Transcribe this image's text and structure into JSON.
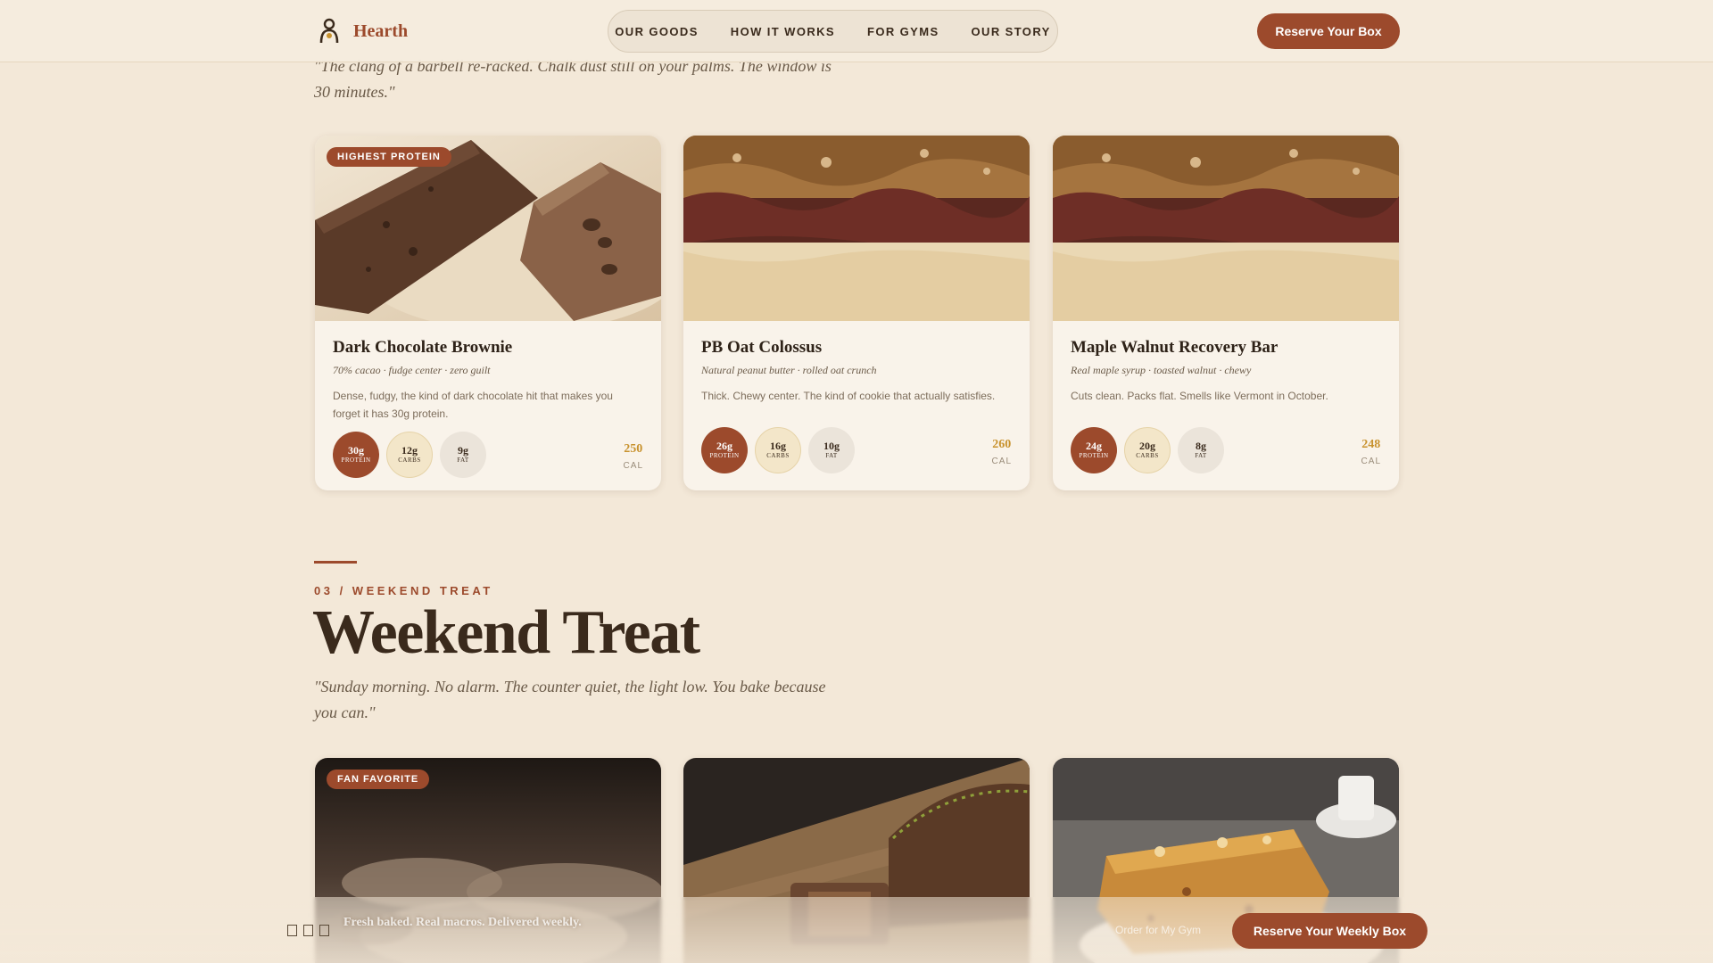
{
  "header": {
    "brand": "Hearth",
    "logo_icon": "chef-person-icon",
    "nav": [
      "OUR GOODS",
      "HOW IT WORKS",
      "FOR GYMS",
      "OUR STORY"
    ],
    "cta": "Reserve Your Box"
  },
  "section2": {
    "quote": "\"The clang of a barbell re-racked. Chalk dust still on your palms. The window is 30 minutes.\"",
    "cards": [
      {
        "badge": "HIGHEST PROTEIN",
        "title": "Dark Chocolate Brownie",
        "tagline": "70% cacao · fudge center · zero guilt",
        "desc": "Dense, fudgy, the kind of dark chocolate hit that makes you forget it has 30g protein.",
        "protein": "30g",
        "carbs": "12g",
        "fat": "9g",
        "cal": "250"
      },
      {
        "badge": "",
        "title": "PB Oat Colossus",
        "tagline": "Natural peanut butter · rolled oat crunch",
        "desc": "Thick. Chewy center. The kind of cookie that actually satisfies.",
        "protein": "26g",
        "carbs": "16g",
        "fat": "10g",
        "cal": "260"
      },
      {
        "badge": "",
        "title": "Maple Walnut Recovery Bar",
        "tagline": "Real maple syrup · toasted walnut · chewy",
        "desc": "Cuts clean. Packs flat. Smells like Vermont in October.",
        "protein": "24g",
        "carbs": "20g",
        "fat": "8g",
        "cal": "248"
      }
    ],
    "labels": {
      "protein": "PROTEIN",
      "carbs": "CARBS",
      "fat": "FAT",
      "cal": "CAL"
    }
  },
  "section3": {
    "number": "03 / WEEKEND TREAT",
    "title": "Weekend Treat",
    "quote": "\"Sunday morning. No alarm. The counter quiet, the light low. You bake because you can.\"",
    "cards": [
      {
        "badge": "FAN FAVORITE"
      },
      {
        "badge": ""
      },
      {
        "badge": ""
      }
    ]
  },
  "bottom_bar": {
    "text": "Fresh baked. Real macros. Delivered weekly.",
    "link": "Order for My Gym",
    "cta": "Reserve Your Weekly Box"
  },
  "colors": {
    "background": "#f3e8d8",
    "accent": "#9c4a2c",
    "calorie": "#c8922e",
    "text": "#3a2a1c"
  }
}
